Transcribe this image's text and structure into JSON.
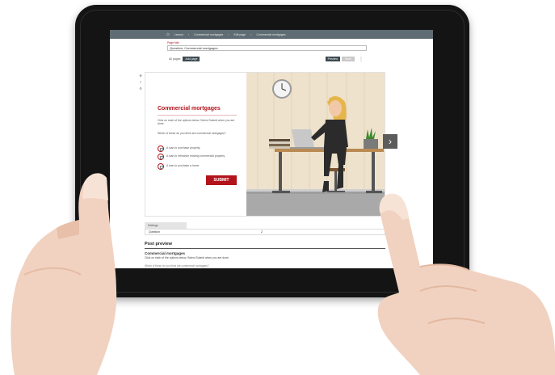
{
  "topnav": {
    "crumbs": [
      "Lesson",
      "Commercial mortgages",
      "Edit page",
      "Commercial mortgages"
    ]
  },
  "page": {
    "label": "Page title",
    "title_value": "Question: Commercial mortgages"
  },
  "toolbar": {
    "all_pages": "All pages",
    "add_page": "Add page",
    "preview": "Preview",
    "save": "Save"
  },
  "slide": {
    "title": "Commercial mortgages",
    "description": "Click on each of the options below. Select Submit when you are done.",
    "description2": "Which of these do you think are commercial mortgages?",
    "options": [
      "A loan to purchase property",
      "A loan to refinance existing commercial property",
      "A loan to purchase a home"
    ],
    "submit_label": "SUBMIT"
  },
  "table": {
    "header": "Settings",
    "row_label": "Question",
    "row_value": "2"
  },
  "post_preview": {
    "heading": "Post preview",
    "title": "Commercial mortgages",
    "text": "Click on each of the options below. Select Submit when you are done.",
    "text2": "Which of these do you think are commercial mortgages?"
  },
  "colors": {
    "brand_red": "#b3131b",
    "nav_grey": "#5f6c73"
  }
}
